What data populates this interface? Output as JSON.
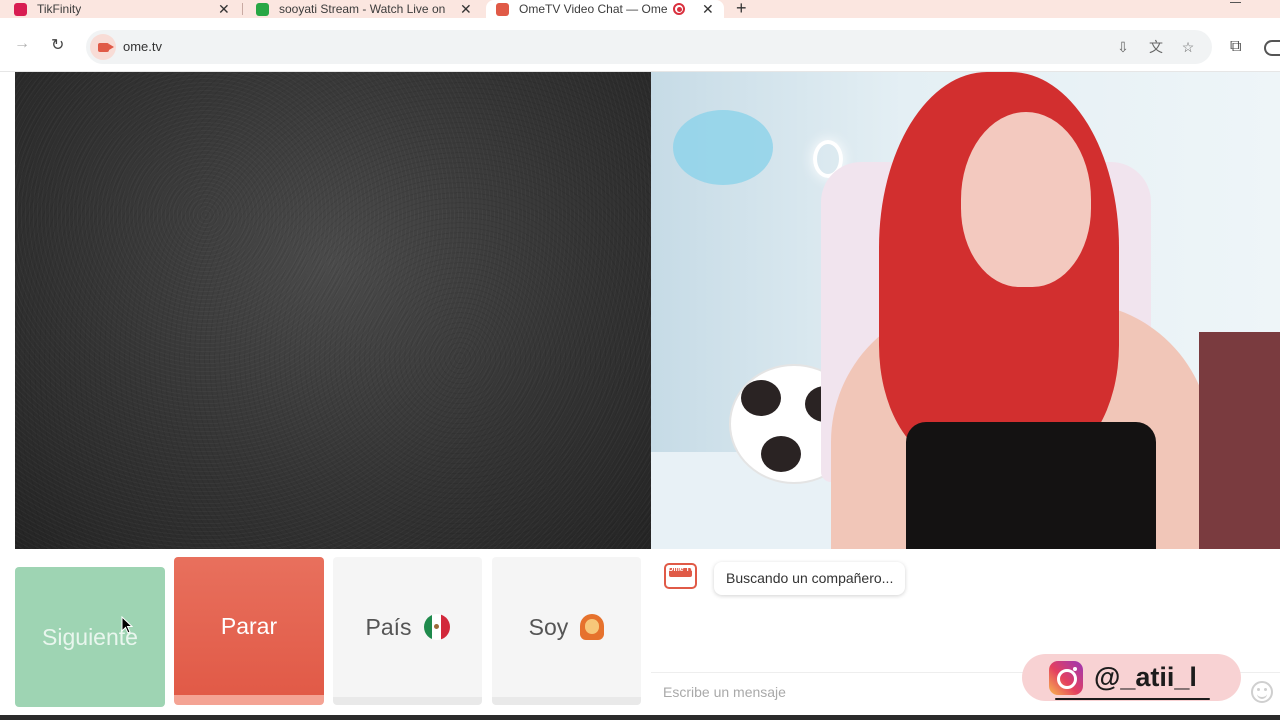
{
  "browser": {
    "tabs": [
      {
        "title": "TikFinity",
        "color": "#d81d52"
      },
      {
        "title": "sooyati Stream - Watch Live on",
        "color": "#28a745"
      },
      {
        "title": "OmeTV Video Chat — Ome",
        "color": "#e05a47",
        "active": true,
        "recording": true
      }
    ],
    "new_tab_label": "+",
    "close_glyph": "✕",
    "url": "ome.tv"
  },
  "controls": {
    "next_label": "Siguiente",
    "stop_label": "Parar",
    "country_label": "País",
    "country_flag": "mexico-flag",
    "gender_label": "Soy",
    "gender_icon": "woman-emoji"
  },
  "chat": {
    "status_message": "Buscando un compañero...",
    "input_placeholder": "Escribe un mensaje",
    "logo_text": "Ome TV"
  },
  "watermark": {
    "handle": "@_atii_l",
    "icon": "instagram-icon"
  },
  "colors": {
    "next": "#9ed4b3",
    "stop": "#e15a47",
    "brand": "#e05a47"
  }
}
